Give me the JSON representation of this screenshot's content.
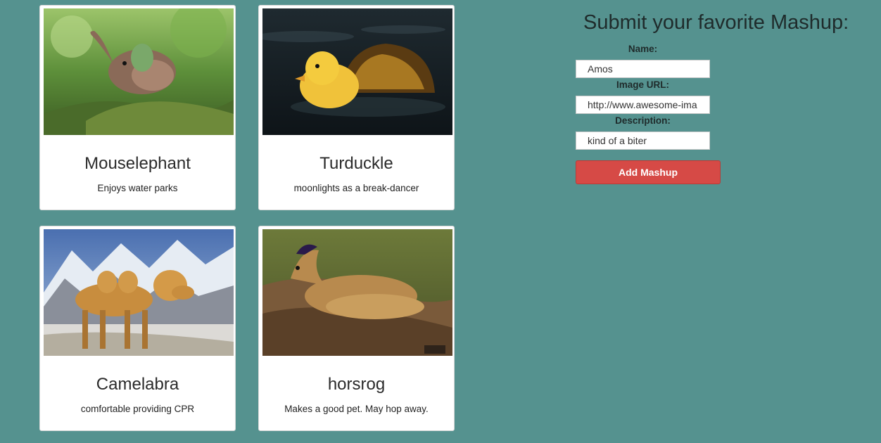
{
  "mashups": [
    {
      "title": "Mouselephant",
      "description": "Enjoys water parks"
    },
    {
      "title": "Turduckle",
      "description": "moonlights as a break-dancer"
    },
    {
      "title": "Camelabra",
      "description": "comfortable providing CPR"
    },
    {
      "title": "horsrog",
      "description": "Makes a good pet. May hop away."
    }
  ],
  "form": {
    "heading": "Submit your favorite Mashup:",
    "name_label": "Name:",
    "name_value": "Amos",
    "url_label": "Image URL:",
    "url_value": "http://www.awesome-ima",
    "desc_label": "Description:",
    "desc_value": "kind of a biter",
    "submit_label": "Add Mashup"
  },
  "colors": {
    "background": "#55928f",
    "button": "#d64a46",
    "card": "#ffffff"
  }
}
